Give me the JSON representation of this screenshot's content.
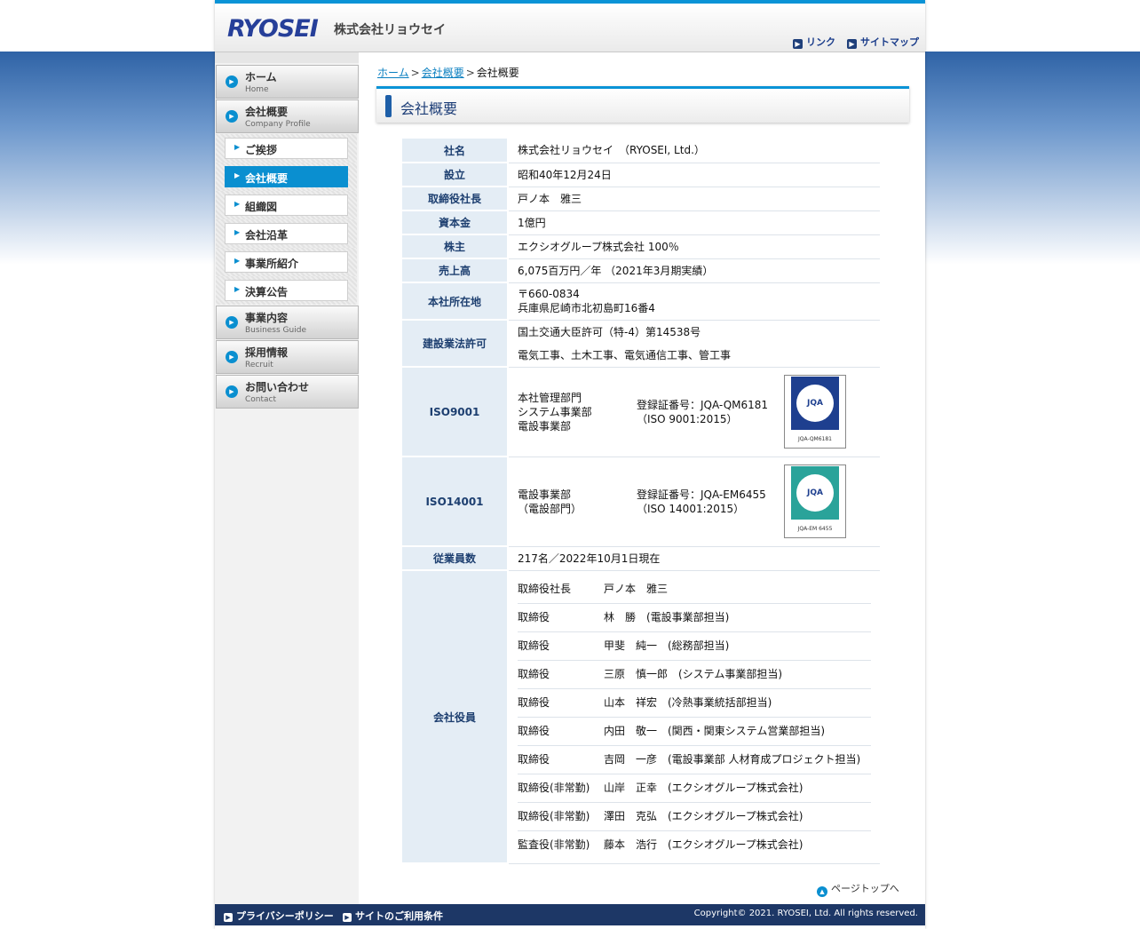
{
  "header": {
    "logo": "RYOSEI",
    "logo_jp": "株式会社リョウセイ",
    "links": [
      "リンク",
      "サイトマップ"
    ]
  },
  "sidebar": {
    "main": [
      {
        "jp": "ホーム",
        "en": "Home"
      },
      {
        "jp": "会社概要",
        "en": "Company Profile"
      },
      {
        "jp": "事業内容",
        "en": "Business Guide"
      },
      {
        "jp": "採用情報",
        "en": "Recruit"
      },
      {
        "jp": "お問い合わせ",
        "en": "Contact"
      }
    ],
    "sub": [
      "ご挨拶",
      "会社概要",
      "組織図",
      "会社沿革",
      "事業所紹介",
      "決算公告"
    ],
    "active_sub": "会社概要"
  },
  "breadcrumb": {
    "home": "ホーム",
    "section": "会社概要",
    "current": "会社概要"
  },
  "page_title": "会社概要",
  "profile": {
    "name_label": "社名",
    "name": "株式会社リョウセイ　（RYOSEI, Ltd.）",
    "founded_label": "設立",
    "founded": "昭和40年12月24日",
    "president_label": "取締役社長",
    "president": "戸ノ本　雅三",
    "capital_label": "資本金",
    "capital": "1億円",
    "shareholder_label": "株主",
    "shareholder": "エクシオグループ株式会社 100％",
    "sales_label": "売上高",
    "sales": "6,075百万円／年 （2021年3月期実績）",
    "address_label": "本社所在地",
    "address_zip": "〒660-0834",
    "address": "兵庫県尼崎市北初島町16番4",
    "license_label": "建設業法許可",
    "license": "国土交通大臣許可（特-4）第14538号",
    "license_types": "電気工事、土木工事、電気通信工事、管工事",
    "iso9001_label": "ISO9001",
    "iso9001_depts": [
      "本社管理部門",
      "システム事業部",
      "電設事業部"
    ],
    "iso9001_reg": "登録証番号：JQA-QM6181",
    "iso9001_std": "（ISO 9001:2015）",
    "iso9001_logo": {
      "text": "JQA",
      "caption": "JQA-QM6181",
      "color": "#1e3f8f"
    },
    "iso14001_label": "ISO14001",
    "iso14001_depts": [
      "電設事業部",
      "（電設部門）"
    ],
    "iso14001_reg": "登録証番号：JQA-EM6455",
    "iso14001_std": "（ISO 14001:2015）",
    "iso14001_logo": {
      "text": "JQA",
      "caption": "JQA-EM 6455",
      "color": "#2aa39a"
    },
    "employees_label": "従業員数",
    "employees": "217名／2022年10月1日現在",
    "officers_label": "会社役員",
    "officers": [
      {
        "title": "取締役社長",
        "detail": "戸ノ本　雅三"
      },
      {
        "title": "取締役",
        "detail": "林　勝　(電設事業部担当)"
      },
      {
        "title": "取締役",
        "detail": "甲斐　純一　(総務部担当)"
      },
      {
        "title": "取締役",
        "detail": "三原　慎一郎　(システム事業部担当)"
      },
      {
        "title": "取締役",
        "detail": "山本　祥宏　(冷熱事業統括部担当)"
      },
      {
        "title": "取締役",
        "detail": "内田　敬一　(関西・関東システム営業部担当)"
      },
      {
        "title": "取締役",
        "detail": "吉岡　一彦　(電設事業部 人材育成プロジェクト担当)"
      },
      {
        "title": "取締役(非常勤)",
        "detail": "山岸　正幸　(エクシオグループ株式会社)"
      },
      {
        "title": "取締役(非常勤)",
        "detail": "澤田　克弘　(エクシオグループ株式会社)"
      },
      {
        "title": "監査役(非常勤)",
        "detail": "藤本　浩行　(エクシオグループ株式会社)"
      }
    ]
  },
  "pagetop": "ページトップへ",
  "footer": {
    "links": [
      "プライバシーポリシー",
      "サイトのご利用条件"
    ],
    "copyright": "Copyright© 2021. RYOSEI, Ltd. All rights reserved."
  },
  "colors": {
    "accent": "#0a93d6",
    "navy": "#1d3766",
    "th_bg": "#e4edf5"
  }
}
